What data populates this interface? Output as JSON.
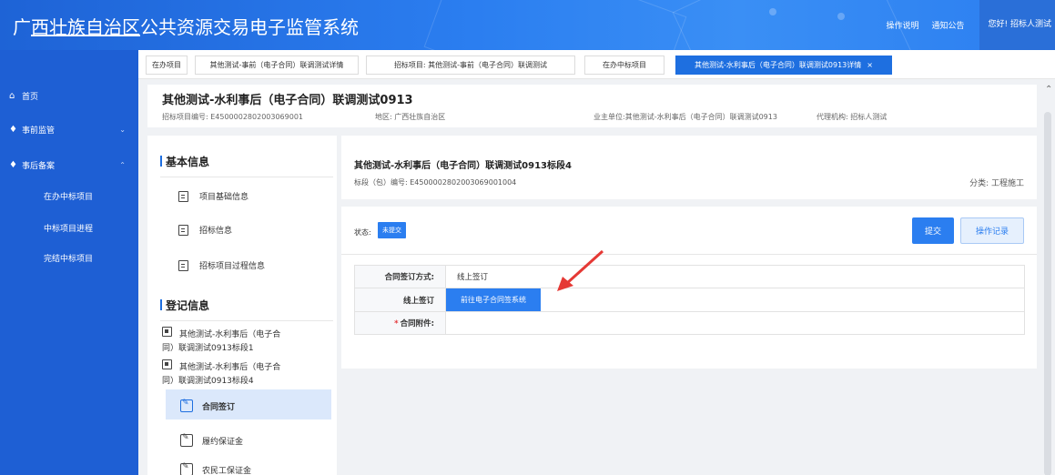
{
  "app": {
    "title_pre": "广",
    "title_underlined": "西壮族自治区",
    "title_post": "公共资源交易电子监管系统"
  },
  "top_links": {
    "help": "操作说明",
    "notice": "通知公告",
    "user": "您好! 招标人测试"
  },
  "sidebar": {
    "home": "首页",
    "pre": "事前监管",
    "post": "事后备案",
    "sub": [
      "在办中标项目",
      "中标项目进程",
      "完结中标项目"
    ]
  },
  "tabs": [
    "在办项目",
    "其他测试-事前（电子合同）联调测试详情",
    "招标项目: 其他测试-事前（电子合同）联调测试",
    "在办中标项目",
    "其他测试-水利事后（电子合同）联调测试0913详情"
  ],
  "project": {
    "title": "其他测试-水利事后（电子合同）联调测试0913",
    "code": "招标项目编号: E4500002802003069001",
    "region": "地区: 广西壮族自治区",
    "owner": "业主单位:其他测试-水利事后（电子合同）联调测试0913",
    "agent": "代理机构: 招标人测试"
  },
  "leftnav": {
    "basic_title": "基本信息",
    "basic_items": [
      "项目基础信息",
      "招标信息",
      "招标项目过程信息"
    ],
    "reg_title": "登记信息",
    "packages": [
      {
        "line1": "其他测试-水利事后（电子合",
        "line2": "同）联调测试0913标段1"
      },
      {
        "line1": "其他测试-水利事后（电子合",
        "line2": "同）联调测试0913标段4"
      }
    ],
    "reg_items": [
      "合同签订",
      "履约保证金",
      "农民工保证金"
    ]
  },
  "lot": {
    "title": "其他测试-水利事后（电子合同）联调测试0913标段4",
    "code": "标段（包）编号: E4500002802003069001004",
    "category": "分类: 工程施工"
  },
  "status": {
    "label": "状态:",
    "value": "未提交"
  },
  "buttons": {
    "submit": "提交",
    "log": "操作记录",
    "goto": "前往电子合同签系统"
  },
  "form": {
    "sign_method_label": "合同签订方式:",
    "sign_method_value": "线上签订",
    "online_label": "线上签订",
    "attachment_label": "合同附件:"
  },
  "colors": {
    "accent": "#2b7ef0",
    "sidebar": "#1e5fd4",
    "arrow": "#e53935"
  }
}
